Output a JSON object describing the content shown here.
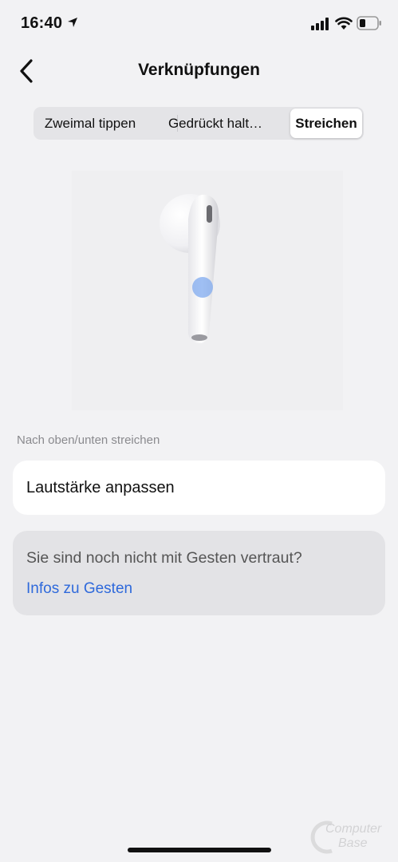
{
  "status_bar": {
    "time": "16:40"
  },
  "nav": {
    "title": "Verknüpfungen"
  },
  "segments": {
    "items": [
      "Zweimal tippen",
      "Gedrückt halt…",
      "Streichen"
    ],
    "selected": "Streichen"
  },
  "gesture": {
    "section_label": "Nach oben/unten streichen",
    "action": "Lautstärke anpassen"
  },
  "help": {
    "question": "Sie sind noch nicht mit Gesten vertraut?",
    "link": "Infos zu Gesten"
  },
  "watermark": {
    "line1": "Computer",
    "line2": "Base"
  },
  "colors": {
    "accent": "#2e69db",
    "background": "#f2f2f4",
    "touch_dot": "#7fa9ef"
  }
}
